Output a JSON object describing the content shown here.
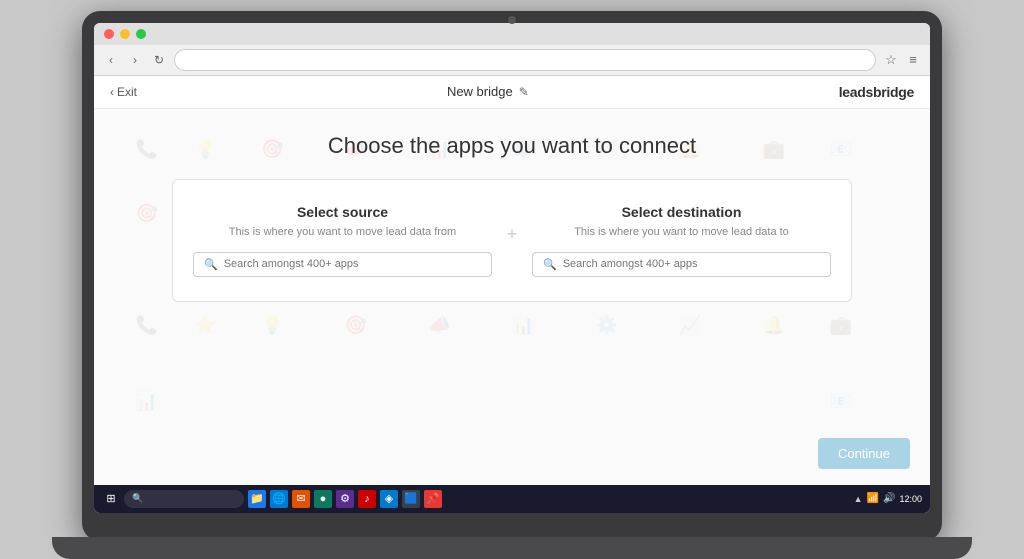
{
  "browser": {
    "nav": {
      "back": "‹",
      "forward": "›",
      "refresh": "↻"
    }
  },
  "header": {
    "exit_icon": "‹",
    "exit_label": "Exit",
    "bridge_title": "New bridge",
    "edit_icon": "✎",
    "logo": "leadsbridge"
  },
  "page": {
    "title": "Choose the apps you want to connect",
    "source": {
      "title": "Select source",
      "subtitle": "This is where you want to move lead data from",
      "search_placeholder": "Search amongst 400+ apps"
    },
    "destination": {
      "title": "Select destination",
      "subtitle": "This is where you want to move lead data to",
      "search_placeholder": "Search amongst 400+ apps"
    },
    "plus_icon": "+",
    "continue_label": "Continue"
  },
  "bg_icons": [
    "📞",
    "💡",
    "🎯",
    "📣",
    "📊",
    "⚙️",
    "📈",
    "🔔",
    "💼",
    "📧",
    "🔗",
    "⭐"
  ],
  "taskbar": {
    "icons": [
      "⊞",
      "🔍",
      "📁",
      "🌐",
      "✉",
      "🔵",
      "⚙",
      "🎵",
      "📷",
      "🟦",
      "📌"
    ],
    "right_icons": [
      "▲",
      "📶",
      "🔊",
      "🕐"
    ]
  }
}
